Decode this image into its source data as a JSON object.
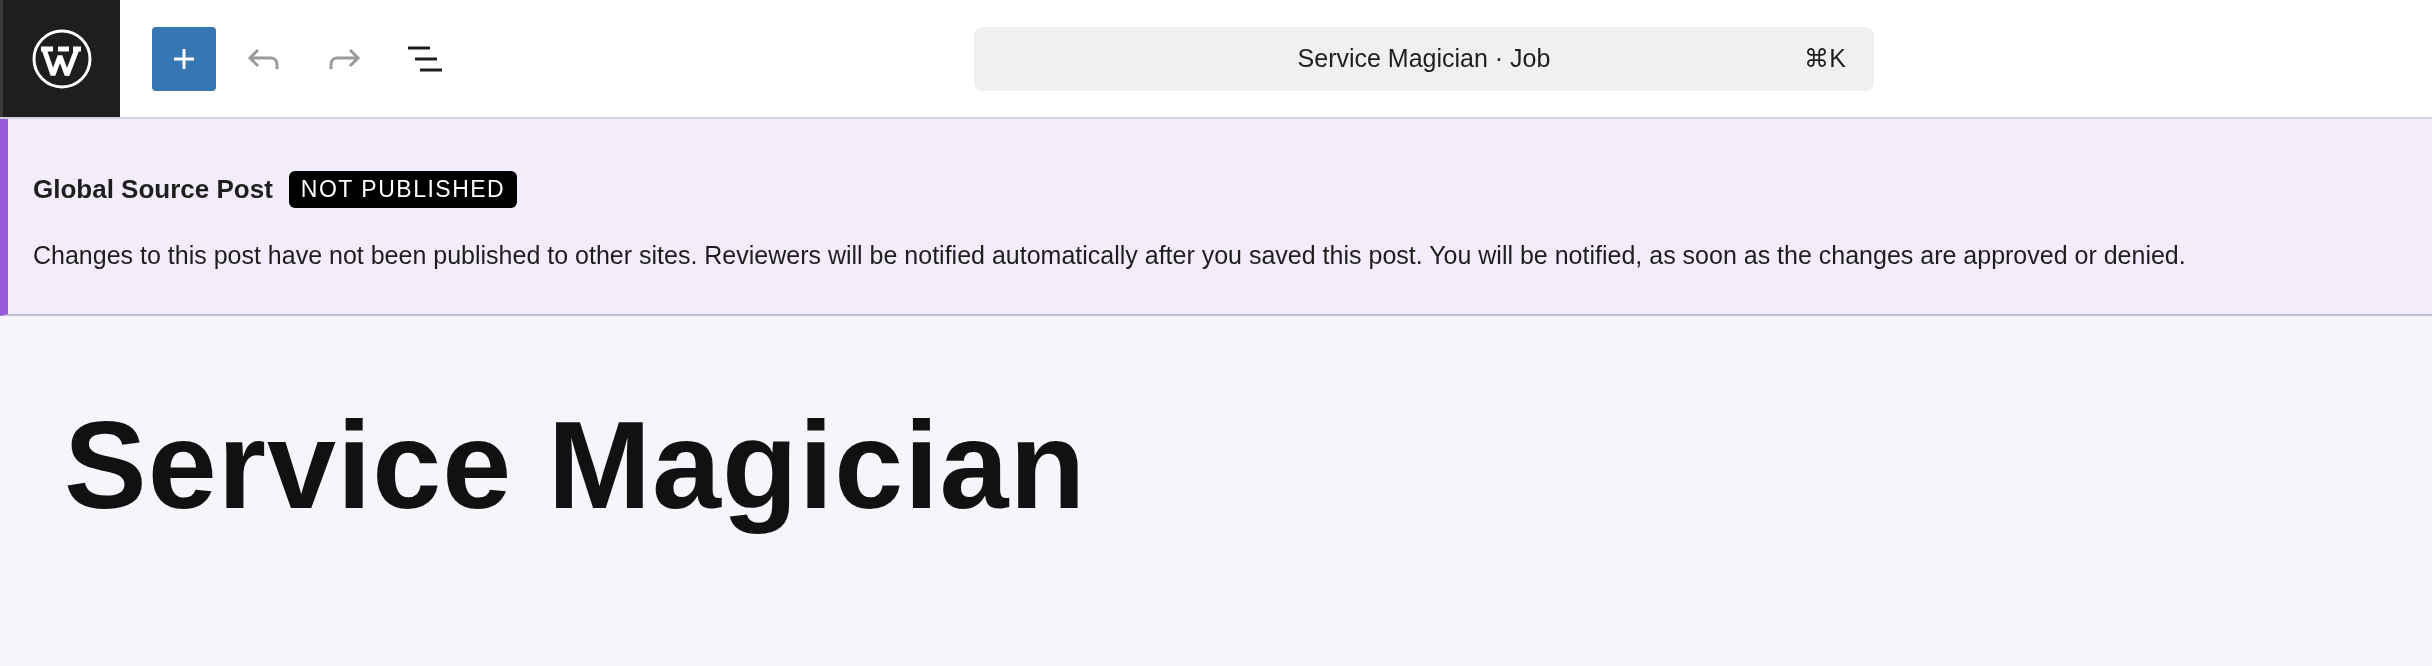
{
  "toolbar": {
    "buttons": [
      {
        "kind": "add",
        "disabled": false
      },
      {
        "kind": "undo",
        "disabled": true
      },
      {
        "kind": "redo",
        "disabled": true
      },
      {
        "kind": "list",
        "disabled": false
      }
    ]
  },
  "command_bar": {
    "title": "Service Magician · Job",
    "shortcut": "⌘K"
  },
  "notice": {
    "title": "Global Source Post",
    "badge": "NOT PUBLISHED",
    "message": "Changes to this post have not been published to other sites. Reviewers will be notified automatically after you saved this post. You will be notified, as soon as the changes are approved or denied."
  },
  "post_title": "Service Magician"
}
